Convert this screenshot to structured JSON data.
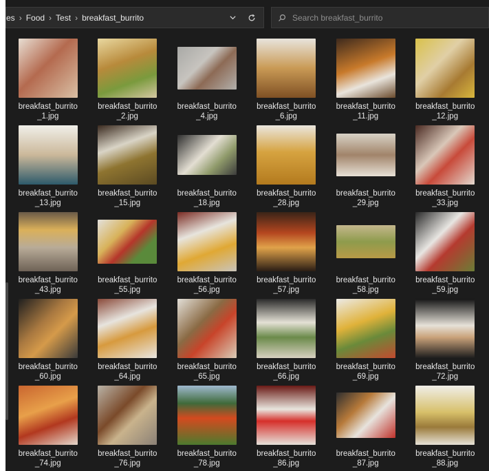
{
  "breadcrumb": {
    "segments": [
      "es",
      "Food",
      "Test",
      "breakfast_burrito"
    ],
    "separator": "›"
  },
  "pathbar": {
    "dropdown_icon": "chevron-down-icon",
    "refresh_icon": "refresh-icon"
  },
  "search": {
    "placeholder": "Search breakfast_burrito",
    "icon": "search-icon"
  },
  "colors": {
    "background": "#1c1c1c",
    "box": "#2b2b2b",
    "text": "#e6e6e6"
  },
  "files": [
    {
      "line1": "breakfast_burrito",
      "line2": "_1.jpg",
      "bg": "linear-gradient(135deg,#e8ded3,#b46a4f 45%,#d9c0a5)"
    },
    {
      "line1": "breakfast_burrito",
      "line2": "_2.jpg",
      "bg": "linear-gradient(160deg,#e9d8a0,#b88a3b 40%,#7a9a3d 70%,#d5c7a2)"
    },
    {
      "line1": "breakfast_burrito",
      "line2": "_4.jpg",
      "bg": "linear-gradient(135deg,#a9a9a6,#c7c4bf 40%,#8d6a55 60%,#b2b0ac)",
      "w": 86,
      "h": 62
    },
    {
      "line1": "breakfast_burrito",
      "line2": "_6.jpg",
      "bg": "linear-gradient(180deg,#e8e4dc,#c99a55 50%,#7f5024)"
    },
    {
      "line1": "breakfast_burrito",
      "line2": "_11.jpg",
      "bg": "linear-gradient(160deg,#3e2a1d,#c87a2b 45%,#e9e4dc 70%,#6a4a2c)"
    },
    {
      "line1": "breakfast_burrito",
      "line2": "_12.jpg",
      "bg": "linear-gradient(135deg,#d9c14a,#e0cfa6 40%,#a77a32 70%,#d8b73d)"
    },
    {
      "line1": "breakfast_burrito",
      "line2": "_13.jpg",
      "bg": "linear-gradient(180deg,#f0efe9,#cbb89a 50%,#2d5a6b)"
    },
    {
      "line1": "breakfast_burrito",
      "line2": "_15.jpg",
      "bg": "linear-gradient(160deg,#3a2a1f,#d9d4c6 35%,#8e7430 60%,#5b4a22)"
    },
    {
      "line1": "breakfast_burrito",
      "line2": "_18.jpg",
      "bg": "linear-gradient(135deg,#2f2f2f,#e3ded2 45%,#8f9a6a 70%,#3c3c3c)",
      "w": 86,
      "h": 58
    },
    {
      "line1": "breakfast_burrito",
      "line2": "_28.jpg",
      "bg": "linear-gradient(180deg,#eae6de,#d6a340 45%,#b37a1e)"
    },
    {
      "line1": "breakfast_burrito",
      "line2": "_29.jpg",
      "bg": "linear-gradient(180deg,#d8d2c6,#a1846a 50%,#e7e1d6)",
      "w": 86,
      "h": 62
    },
    {
      "line1": "breakfast_burrito",
      "line2": "_33.jpg",
      "bg": "linear-gradient(135deg,#4a2a22,#d9c7b8 40%,#c84a3a 60%,#e3d9cf)"
    },
    {
      "line1": "breakfast_burrito",
      "line2": "_43.jpg",
      "bg": "linear-gradient(180deg,#6a5a48,#dab05a 30%,#b8ab98 60%,#6e6256)"
    },
    {
      "line1": "breakfast_burrito",
      "line2": "_55.jpg",
      "bg": "linear-gradient(135deg,#e3e1dc,#d8b25a 35%,#b5362b 55%,#5a8a3b 75%)",
      "w": 86,
      "h": 64
    },
    {
      "line1": "breakfast_burrito",
      "line2": "_56.jpg",
      "bg": "linear-gradient(160deg,#7b2c24,#e7e4dd 35%,#e0a834 65%,#c9c4bb)"
    },
    {
      "line1": "breakfast_burrito",
      "line2": "_57.jpg",
      "bg": "linear-gradient(180deg,#3a2418,#b4461f 35%,#e0a24a 60%,#2a1d15)"
    },
    {
      "line1": "breakfast_burrito",
      "line2": "_58.jpg",
      "bg": "linear-gradient(180deg,#c4b78c,#8e9b4c 50%,#b89a47)",
      "w": 86,
      "h": 48
    },
    {
      "line1": "breakfast_burrito",
      "line2": "_59.jpg",
      "bg": "linear-gradient(135deg,#2a2a2a,#e8e6e2 40%,#b53a2f 60%,#6b7d36)"
    },
    {
      "line1": "breakfast_burrito",
      "line2": "_60.jpg",
      "bg": "linear-gradient(135deg,#1f1f1f,#a87840 40%,#d59a4a 60%,#3a3a3a)"
    },
    {
      "line1": "breakfast_burrito",
      "line2": "_64.jpg",
      "bg": "linear-gradient(160deg,#8a4a3a,#e7e4de 35%,#d79a3e 60%,#e8e6e2)"
    },
    {
      "line1": "breakfast_burrito",
      "line2": "_65.jpg",
      "bg": "linear-gradient(135deg,#e2dfd8,#8a6a44 40%,#c8442a 60%,#d9cdb8)"
    },
    {
      "line1": "breakfast_burrito",
      "line2": "_66.jpg",
      "bg": "linear-gradient(180deg,#2a2a2a,#e4e1d5 40%,#6b8a4a 65%,#d7d0c0)"
    },
    {
      "line1": "breakfast_burrito",
      "line2": "_69.jpg",
      "bg": "linear-gradient(160deg,#eceae6,#e0b23a 40%,#6a8a3a 65%,#c24a2f)"
    },
    {
      "line1": "breakfast_burrito",
      "line2": "_72.jpg",
      "bg": "linear-gradient(180deg,#161616,#e6e1d8 45%,#c9a27a 65%,#1d1d1d)"
    },
    {
      "line1": "breakfast_burrito",
      "line2": "_74.jpg",
      "bg": "linear-gradient(160deg,#c9652f,#e8a04a 40%,#b2381f 65%,#e4d8cc)"
    },
    {
      "line1": "breakfast_burrito",
      "line2": "_76.jpg",
      "bg": "linear-gradient(135deg,#b9b2a6,#7a4a2a 40%,#c9b38c 60%,#8a8076)"
    },
    {
      "line1": "breakfast_burrito",
      "line2": "_78.jpg",
      "bg": "linear-gradient(180deg,#9fb9cf,#3f6a3a 30%,#d44a1f 55%,#4c7a2e)"
    },
    {
      "line1": "breakfast_burrito",
      "line2": "_86.jpg",
      "bg": "linear-gradient(180deg,#6a1a16,#e8e5de 40%,#d62f2a 60%,#e5e1da)"
    },
    {
      "line1": "breakfast_burrito",
      "line2": "_87.jpg",
      "bg": "linear-gradient(135deg,#2f2f2f,#b77a3a 35%,#e7e3dd 60%,#c0312a)",
      "w": 86,
      "h": 66
    },
    {
      "line1": "breakfast_burrito",
      "line2": "_88.jpg",
      "bg": "linear-gradient(180deg,#f0eee8,#d7c06a 45%,#9a7a3a 70%,#e7e2d7)"
    }
  ]
}
